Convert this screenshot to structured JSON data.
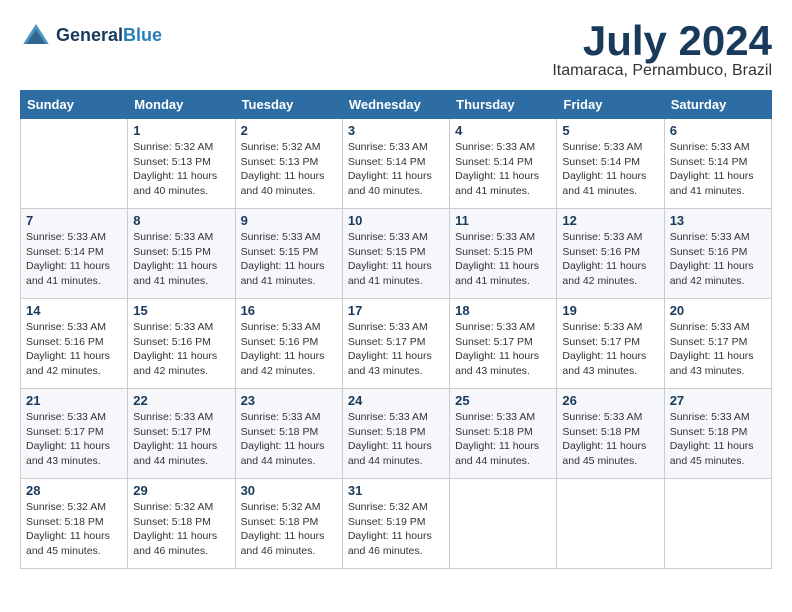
{
  "header": {
    "logo_general": "General",
    "logo_blue": "Blue",
    "month_year": "July 2024",
    "location": "Itamaraca, Pernambuco, Brazil"
  },
  "days_of_week": [
    "Sunday",
    "Monday",
    "Tuesday",
    "Wednesday",
    "Thursday",
    "Friday",
    "Saturday"
  ],
  "weeks": [
    [
      {
        "num": "",
        "rise": "",
        "set": "",
        "daylight": ""
      },
      {
        "num": "1",
        "rise": "5:32 AM",
        "set": "5:13 PM",
        "daylight": "11 hours and 40 minutes."
      },
      {
        "num": "2",
        "rise": "5:32 AM",
        "set": "5:13 PM",
        "daylight": "11 hours and 40 minutes."
      },
      {
        "num": "3",
        "rise": "5:33 AM",
        "set": "5:14 PM",
        "daylight": "11 hours and 40 minutes."
      },
      {
        "num": "4",
        "rise": "5:33 AM",
        "set": "5:14 PM",
        "daylight": "11 hours and 41 minutes."
      },
      {
        "num": "5",
        "rise": "5:33 AM",
        "set": "5:14 PM",
        "daylight": "11 hours and 41 minutes."
      },
      {
        "num": "6",
        "rise": "5:33 AM",
        "set": "5:14 PM",
        "daylight": "11 hours and 41 minutes."
      }
    ],
    [
      {
        "num": "7",
        "rise": "5:33 AM",
        "set": "5:14 PM",
        "daylight": "11 hours and 41 minutes."
      },
      {
        "num": "8",
        "rise": "5:33 AM",
        "set": "5:15 PM",
        "daylight": "11 hours and 41 minutes."
      },
      {
        "num": "9",
        "rise": "5:33 AM",
        "set": "5:15 PM",
        "daylight": "11 hours and 41 minutes."
      },
      {
        "num": "10",
        "rise": "5:33 AM",
        "set": "5:15 PM",
        "daylight": "11 hours and 41 minutes."
      },
      {
        "num": "11",
        "rise": "5:33 AM",
        "set": "5:15 PM",
        "daylight": "11 hours and 41 minutes."
      },
      {
        "num": "12",
        "rise": "5:33 AM",
        "set": "5:16 PM",
        "daylight": "11 hours and 42 minutes."
      },
      {
        "num": "13",
        "rise": "5:33 AM",
        "set": "5:16 PM",
        "daylight": "11 hours and 42 minutes."
      }
    ],
    [
      {
        "num": "14",
        "rise": "5:33 AM",
        "set": "5:16 PM",
        "daylight": "11 hours and 42 minutes."
      },
      {
        "num": "15",
        "rise": "5:33 AM",
        "set": "5:16 PM",
        "daylight": "11 hours and 42 minutes."
      },
      {
        "num": "16",
        "rise": "5:33 AM",
        "set": "5:16 PM",
        "daylight": "11 hours and 42 minutes."
      },
      {
        "num": "17",
        "rise": "5:33 AM",
        "set": "5:17 PM",
        "daylight": "11 hours and 43 minutes."
      },
      {
        "num": "18",
        "rise": "5:33 AM",
        "set": "5:17 PM",
        "daylight": "11 hours and 43 minutes."
      },
      {
        "num": "19",
        "rise": "5:33 AM",
        "set": "5:17 PM",
        "daylight": "11 hours and 43 minutes."
      },
      {
        "num": "20",
        "rise": "5:33 AM",
        "set": "5:17 PM",
        "daylight": "11 hours and 43 minutes."
      }
    ],
    [
      {
        "num": "21",
        "rise": "5:33 AM",
        "set": "5:17 PM",
        "daylight": "11 hours and 43 minutes."
      },
      {
        "num": "22",
        "rise": "5:33 AM",
        "set": "5:17 PM",
        "daylight": "11 hours and 44 minutes."
      },
      {
        "num": "23",
        "rise": "5:33 AM",
        "set": "5:18 PM",
        "daylight": "11 hours and 44 minutes."
      },
      {
        "num": "24",
        "rise": "5:33 AM",
        "set": "5:18 PM",
        "daylight": "11 hours and 44 minutes."
      },
      {
        "num": "25",
        "rise": "5:33 AM",
        "set": "5:18 PM",
        "daylight": "11 hours and 44 minutes."
      },
      {
        "num": "26",
        "rise": "5:33 AM",
        "set": "5:18 PM",
        "daylight": "11 hours and 45 minutes."
      },
      {
        "num": "27",
        "rise": "5:33 AM",
        "set": "5:18 PM",
        "daylight": "11 hours and 45 minutes."
      }
    ],
    [
      {
        "num": "28",
        "rise": "5:32 AM",
        "set": "5:18 PM",
        "daylight": "11 hours and 45 minutes."
      },
      {
        "num": "29",
        "rise": "5:32 AM",
        "set": "5:18 PM",
        "daylight": "11 hours and 46 minutes."
      },
      {
        "num": "30",
        "rise": "5:32 AM",
        "set": "5:18 PM",
        "daylight": "11 hours and 46 minutes."
      },
      {
        "num": "31",
        "rise": "5:32 AM",
        "set": "5:19 PM",
        "daylight": "11 hours and 46 minutes."
      },
      {
        "num": "",
        "rise": "",
        "set": "",
        "daylight": ""
      },
      {
        "num": "",
        "rise": "",
        "set": "",
        "daylight": ""
      },
      {
        "num": "",
        "rise": "",
        "set": "",
        "daylight": ""
      }
    ]
  ]
}
